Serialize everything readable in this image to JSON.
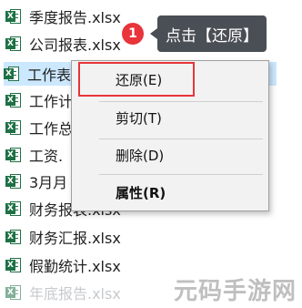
{
  "files": [
    {
      "name": "季度报告.xlsx",
      "faded": false,
      "selected": false
    },
    {
      "name": "公司报表.xlsx",
      "faded": false,
      "selected": false
    },
    {
      "name": "工作表",
      "faded": false,
      "selected": true
    },
    {
      "name": "工作计",
      "faded": false,
      "selected": false
    },
    {
      "name": "工作总",
      "faded": false,
      "selected": false
    },
    {
      "name": "工资.",
      "faded": false,
      "selected": false
    },
    {
      "name": "3月月",
      "faded": false,
      "selected": false
    },
    {
      "name": "财务报表.xlsx",
      "faded": false,
      "selected": false
    },
    {
      "name": "财务汇报.xlsx",
      "faded": false,
      "selected": false
    },
    {
      "name": "假勤统计.xlsx",
      "faded": false,
      "selected": false
    },
    {
      "name": "年底报告.xlsx",
      "faded": true,
      "selected": false
    }
  ],
  "file_icon": {
    "name": "excel-file-icon",
    "badge_text": "X"
  },
  "context_menu": {
    "items": [
      {
        "label": "还原(E)",
        "bold": false
      },
      {
        "label": "剪切(T)",
        "bold": false
      },
      {
        "label": "删除(D)",
        "bold": false
      },
      {
        "label": "属性(R)",
        "bold": true
      }
    ]
  },
  "callout": {
    "step": "1",
    "text": "点击【还原】"
  },
  "watermark": "元码手游网",
  "colors": {
    "accent_red": "#e8343a",
    "selection_blue": "#cce8ff",
    "excel_green": "#1e7145",
    "tooltip_bg": "#4a4e55"
  }
}
